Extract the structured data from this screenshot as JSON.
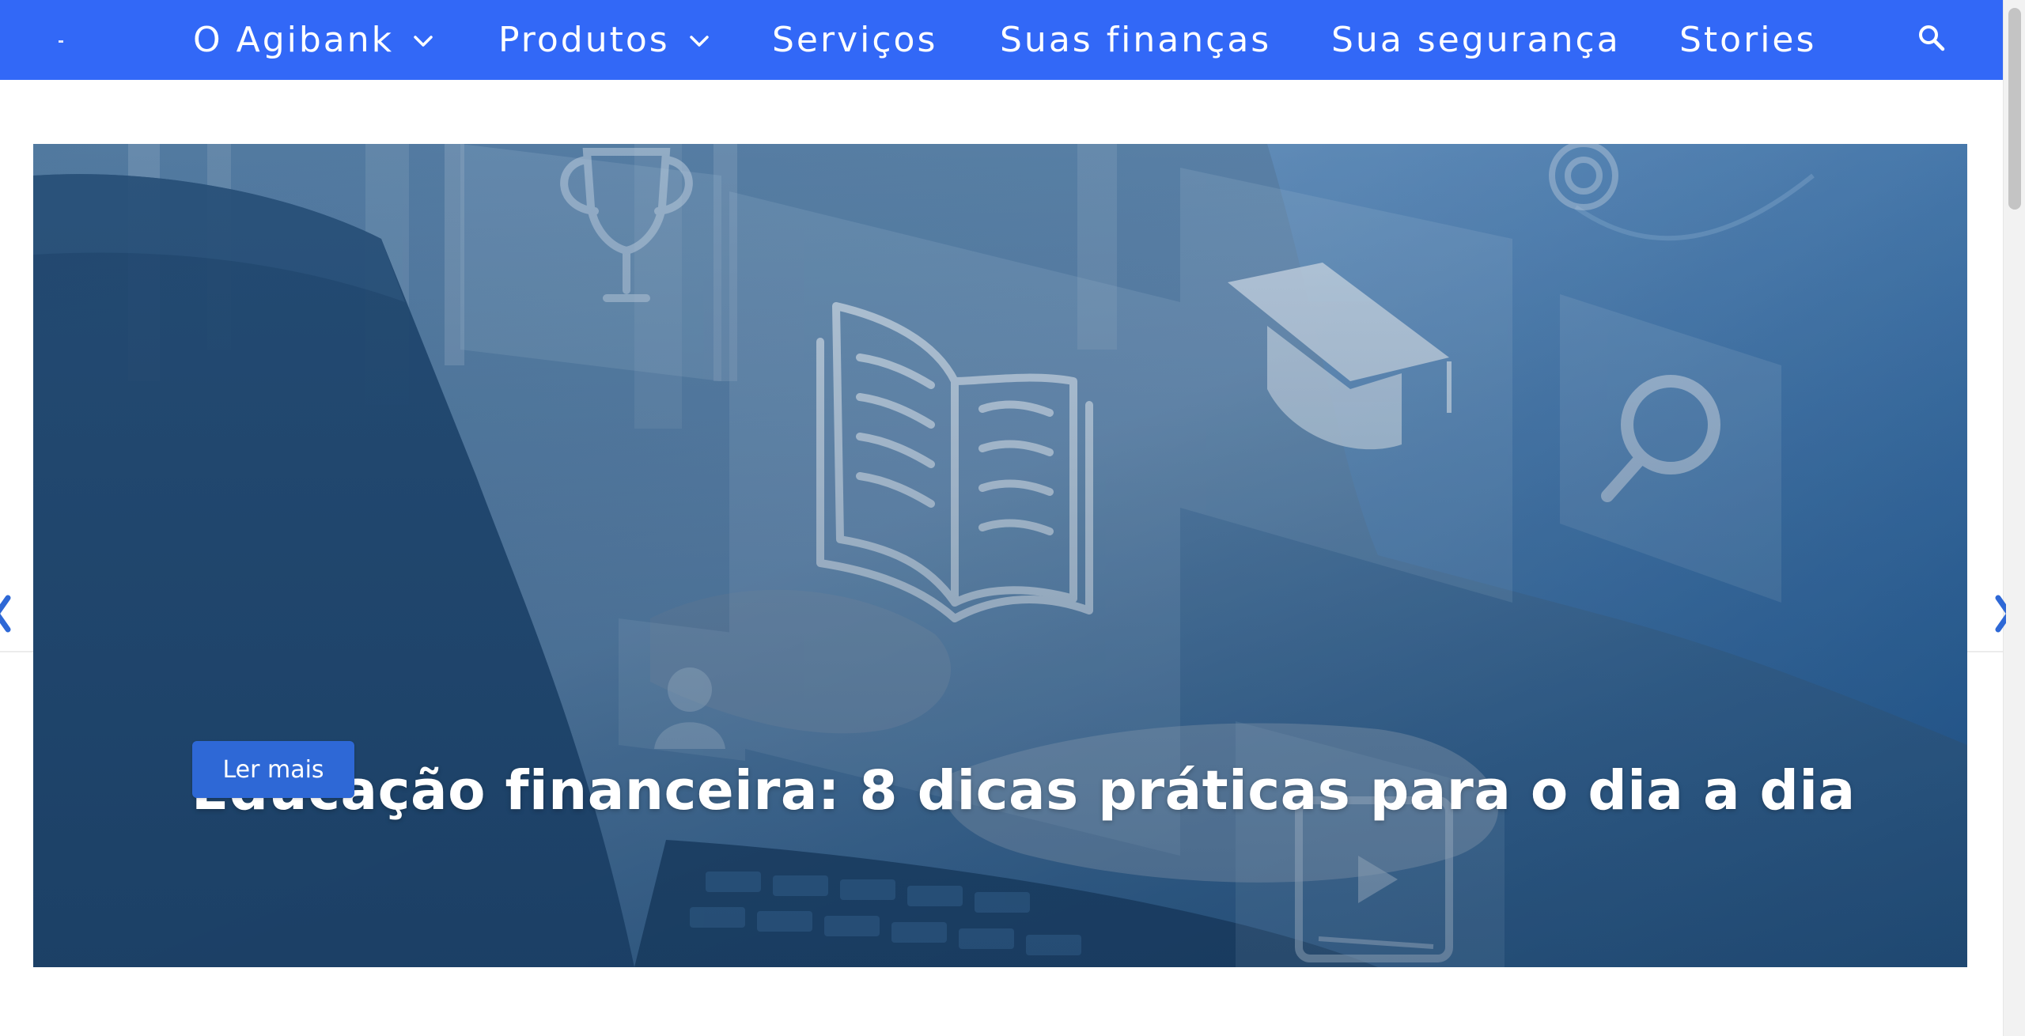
{
  "nav": {
    "items": [
      {
        "label": "O Agibank",
        "has_dropdown": true
      },
      {
        "label": "Produtos",
        "has_dropdown": true
      },
      {
        "label": "Serviços",
        "has_dropdown": false
      },
      {
        "label": "Suas finanças",
        "has_dropdown": false
      },
      {
        "label": "Sua segurança",
        "has_dropdown": false
      },
      {
        "label": "Stories",
        "has_dropdown": false
      }
    ],
    "search_icon": "search-icon",
    "background_color": "#3268f7"
  },
  "hero": {
    "title": "Educação financeira: 8 dicas práticas para o dia a dia",
    "button_label": "Ler mais",
    "button_color": "#2e68d6",
    "image_description_icons": [
      "trophy-icon",
      "book-icon",
      "graduation-cap-icon",
      "magnifier-icon",
      "play-video-icon",
      "user-icon",
      "target-icon"
    ]
  },
  "carousel": {
    "prev_icon": "chevron-left-icon",
    "next_icon": "chevron-right-icon"
  }
}
